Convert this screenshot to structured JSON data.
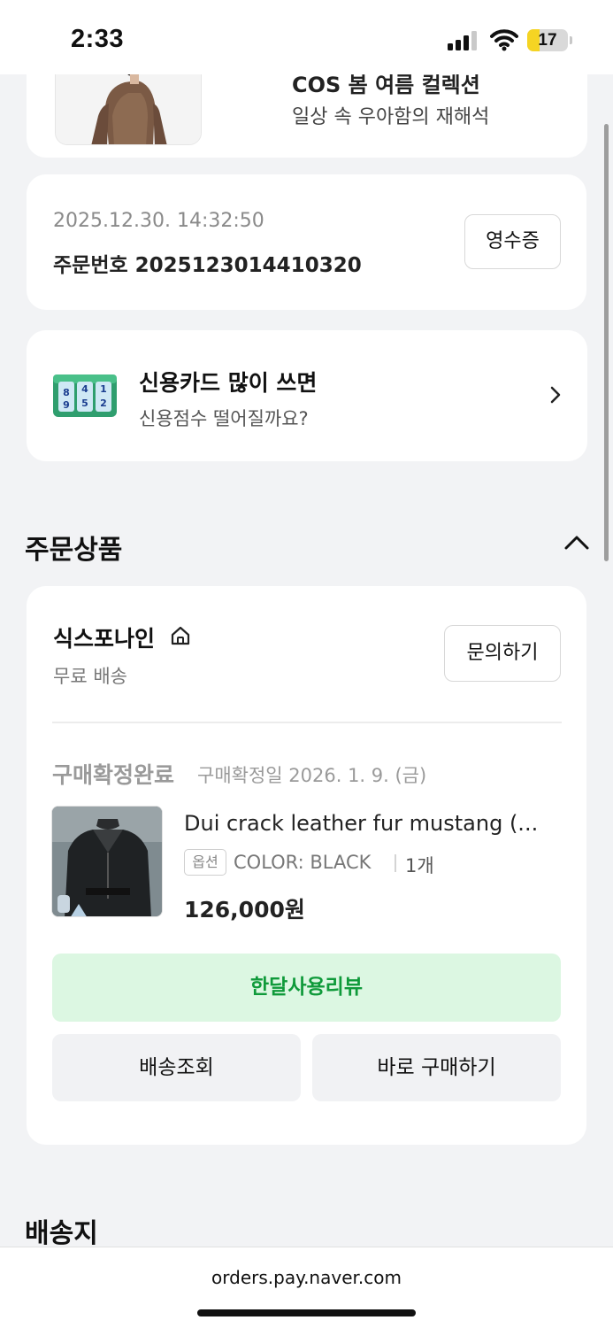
{
  "status_bar": {
    "time": "2:33",
    "battery_level": "17",
    "battery_fraction": 0.17,
    "icons": [
      "signal-icon",
      "wifi-icon",
      "battery-icon"
    ]
  },
  "promo": {
    "title": "COS 봄 여름 컬렉션",
    "subtitle": "일상 속 우아함의 재해석"
  },
  "order": {
    "date": "2025.12.30. 14:32:50",
    "number": "주문번호 2025123014410320",
    "receipt_label": "영수증"
  },
  "ad": {
    "title": "신용카드 많이 쓰면",
    "subtitle": "신용점수 떨어질까요?",
    "icon": "lock-icon"
  },
  "ordered_items": {
    "title": "주문상품",
    "seller": {
      "name": "식스포나인",
      "shipping": "무료 배송",
      "inquiry_label": "문의하기"
    },
    "status": "구매확정완료",
    "status_date": "구매확정일 2026. 1. 9. (금)",
    "product": {
      "name": "Dui crack leather fur mustang (...",
      "option_badge": "옵션",
      "option": "COLOR: BLACK",
      "quantity": "1개",
      "price": "126,000원"
    },
    "review_label": "한달사용리뷰",
    "track_label": "배송조회",
    "buy_again_label": "바로 구매하기"
  },
  "shipping_section": {
    "title": "배송지"
  },
  "browser": {
    "url": "orders.pay.naver.com"
  },
  "colors": {
    "review_bg": "#dcf7e2",
    "review_text": "#0f9a3a",
    "battery_fill": "#f5d423"
  }
}
